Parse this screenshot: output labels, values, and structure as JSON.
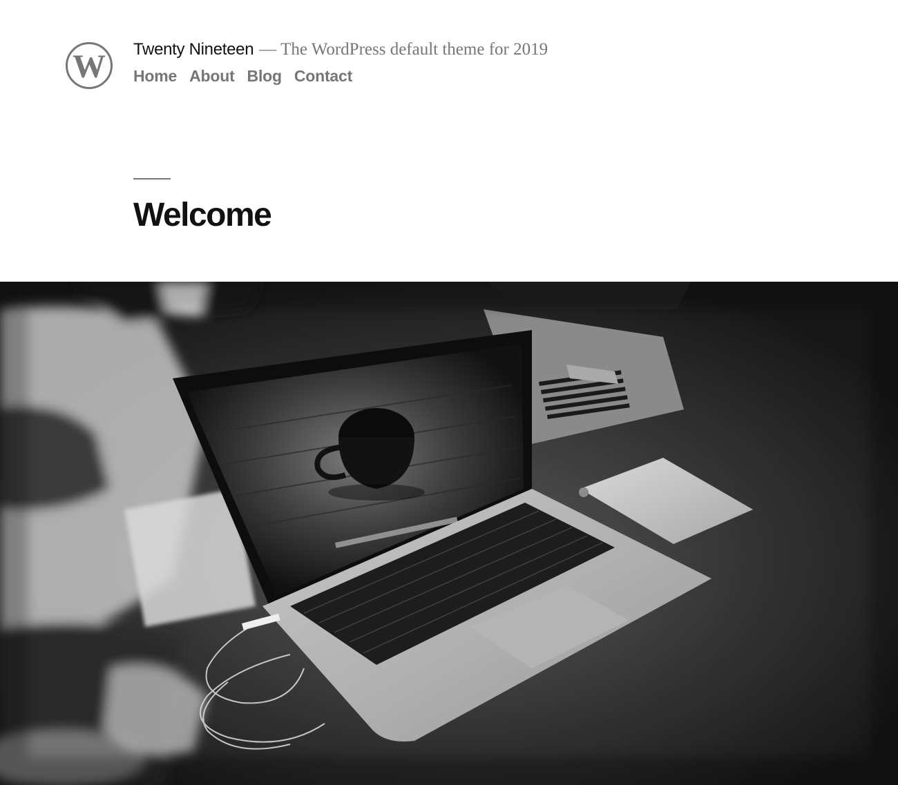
{
  "site": {
    "title": "Twenty Nineteen",
    "description": "— The WordPress default theme for 2019",
    "logo_icon": "wordpress-logo-icon"
  },
  "navigation": {
    "items": [
      {
        "label": "Home"
      },
      {
        "label": "About"
      },
      {
        "label": "Blog"
      },
      {
        "label": "Contact"
      }
    ]
  },
  "page": {
    "title": "Welcome"
  },
  "featured_image": {
    "subject": "laptop-on-desk-photo",
    "tone": "grayscale"
  },
  "colors": {
    "text": "#111111",
    "muted": "#767676",
    "background": "#ffffff"
  }
}
